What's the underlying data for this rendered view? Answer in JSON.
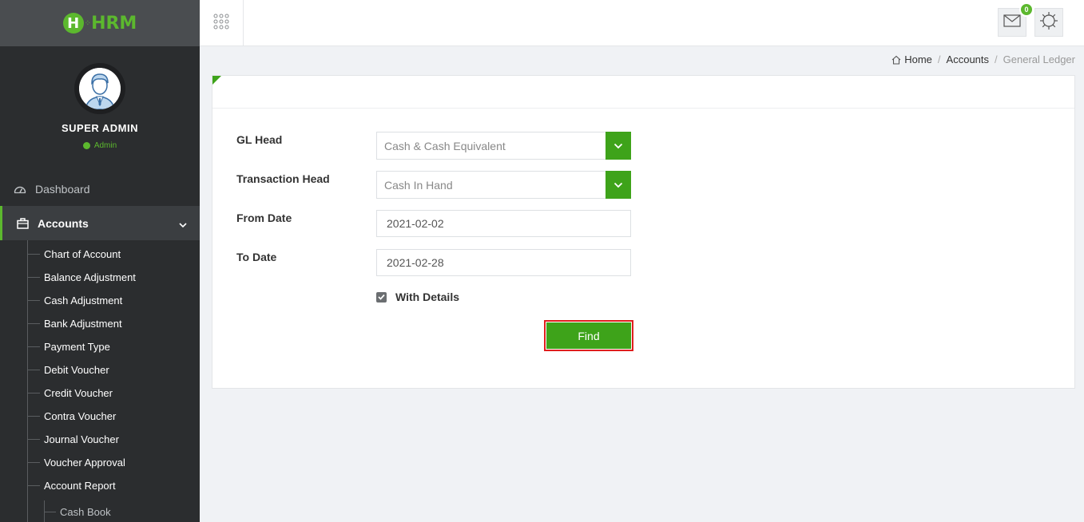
{
  "app": {
    "logo_text": "HRM",
    "logo_letter": "H"
  },
  "user": {
    "name": "SUPER ADMIN",
    "role": "Admin"
  },
  "sidebar": {
    "dashboard_label": "Dashboard",
    "accounts_label": "Accounts",
    "accounts_items": [
      "Chart of Account",
      "Balance Adjustment",
      "Cash Adjustment",
      "Bank Adjustment",
      "Payment Type",
      "Debit Voucher",
      "Credit Voucher",
      "Contra Voucher",
      "Journal Voucher",
      "Voucher Approval",
      "Account Report"
    ],
    "report_items": [
      "Cash Book"
    ]
  },
  "topbar": {
    "mail_count": "0"
  },
  "breadcrumb": {
    "home": "Home",
    "section": "Accounts",
    "current": "General Ledger"
  },
  "form": {
    "gl_head_label": "GL Head",
    "gl_head_value": "Cash & Cash Equivalent",
    "transaction_head_label": "Transaction Head",
    "transaction_head_value": "Cash In Hand",
    "from_date_label": "From Date",
    "from_date_value": "2021-02-02",
    "to_date_label": "To Date",
    "to_date_value": "2021-02-28",
    "with_details_label": "With Details",
    "with_details_checked": true,
    "find_label": "Find"
  },
  "colors": {
    "brand_green": "#3ea31a",
    "sidebar_bg": "#2b2d2f",
    "highlight_border": "#e01e1e"
  }
}
